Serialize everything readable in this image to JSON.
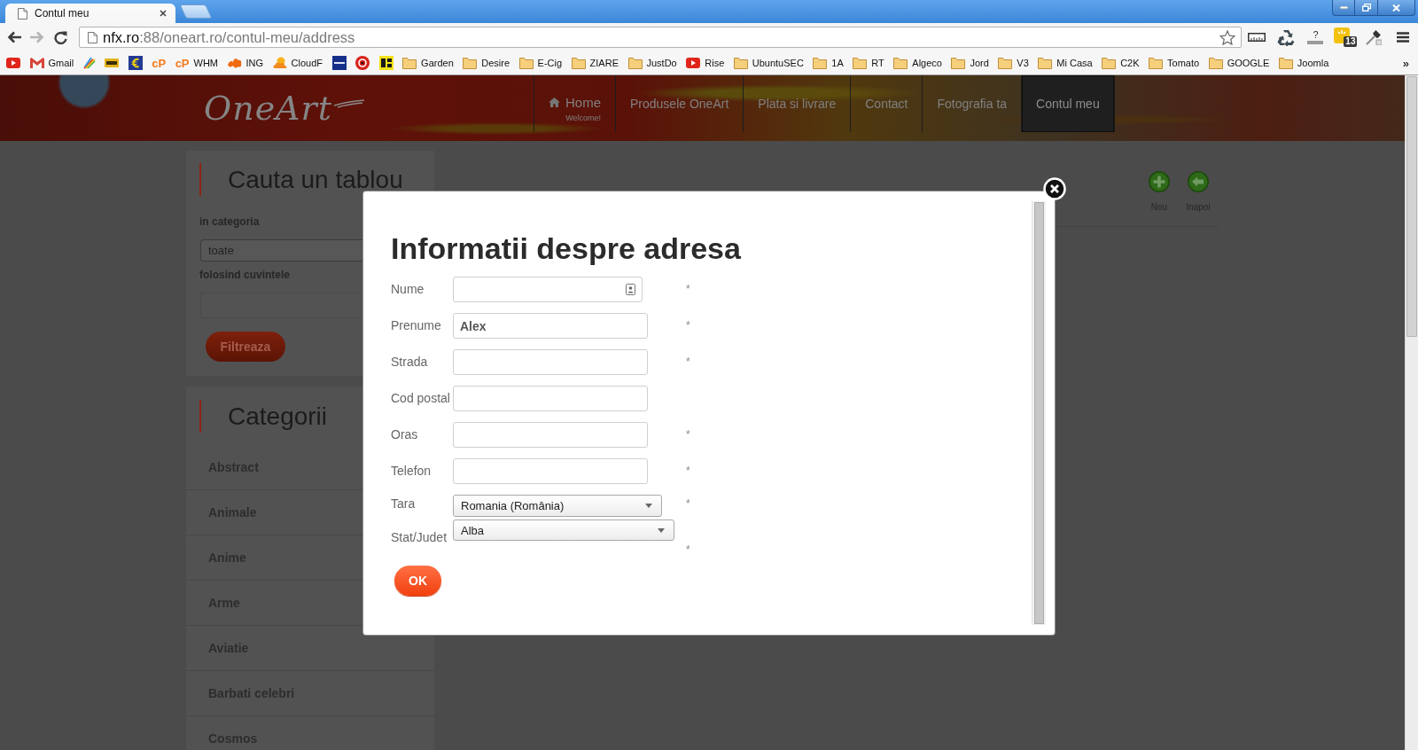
{
  "browser": {
    "tab": {
      "title": "Contul meu"
    },
    "address": {
      "host": "nfx.ro",
      "path": ":88/oneart.ro/contul-meu/address"
    },
    "extensions": [
      {
        "kind": "ruler"
      },
      {
        "kind": "recycle"
      },
      {
        "kind": "help",
        "glyph": "?"
      },
      {
        "kind": "notifier",
        "badge": "13"
      },
      {
        "kind": "dropper"
      },
      {
        "kind": "menu"
      }
    ],
    "bookmarks": [
      {
        "kind": "youtube"
      },
      {
        "kind": "gmail",
        "label": "Gmail"
      },
      {
        "kind": "brush"
      },
      {
        "kind": "imdb"
      },
      {
        "kind": "euro"
      },
      {
        "kind": "cpanel",
        "glyph": "cP"
      },
      {
        "kind": "cpanel",
        "glyph": "cP",
        "label": "WHM"
      },
      {
        "kind": "lion",
        "label": "ING"
      },
      {
        "kind": "cloud",
        "label": "CloudF"
      },
      {
        "kind": "twc"
      },
      {
        "kind": "ball"
      },
      {
        "kind": "cdt"
      },
      {
        "kind": "folder",
        "label": "Garden"
      },
      {
        "kind": "folder",
        "label": "Desire"
      },
      {
        "kind": "folder",
        "label": "E-Cig"
      },
      {
        "kind": "folder",
        "label": "ZIARE"
      },
      {
        "kind": "folder",
        "label": "JustDo"
      },
      {
        "kind": "youtube",
        "label": "Rise"
      },
      {
        "kind": "folder",
        "label": "UbuntuSEC"
      },
      {
        "kind": "folder",
        "label": "1A"
      },
      {
        "kind": "folder",
        "label": "RT"
      },
      {
        "kind": "folder",
        "label": "Algeco"
      },
      {
        "kind": "folder",
        "label": "Jord"
      },
      {
        "kind": "folder",
        "label": "V3"
      },
      {
        "kind": "folder",
        "label": "Mi Casa"
      },
      {
        "kind": "folder",
        "label": "C2K"
      },
      {
        "kind": "folder",
        "label": "Tomato"
      },
      {
        "kind": "folder",
        "label": "GOOGLE"
      },
      {
        "kind": "folder",
        "label": "Joomla"
      }
    ],
    "overflow": "»"
  },
  "site": {
    "logo": "OneArt",
    "nav": [
      {
        "kind": "home",
        "label": "Home",
        "subtitle": "Welcome!",
        "selected": false
      },
      {
        "kind": "link",
        "label": "Produsele OneArt",
        "selected": false
      },
      {
        "kind": "link",
        "label": "Plata si livrare",
        "selected": false
      },
      {
        "kind": "link",
        "label": "Contact",
        "selected": false
      },
      {
        "kind": "link",
        "label": "Fotografia ta",
        "selected": false
      },
      {
        "kind": "link",
        "label": "Contul meu",
        "selected": true
      }
    ]
  },
  "sidebar": {
    "search": {
      "title": "Cauta un tablou",
      "category_label": "in categoria",
      "category_value": "toate",
      "keywords_label": "folosind cuvintele",
      "button": "Filtreaza"
    },
    "categories": {
      "title": "Categorii",
      "items": [
        "Abstract",
        "Animale",
        "Anime",
        "Arme",
        "Aviatie",
        "Barbati celebri",
        "Cosmos"
      ]
    }
  },
  "toolbar": {
    "actions": [
      {
        "kind": "add",
        "label": "Nou"
      },
      {
        "kind": "back",
        "label": "Inapoi"
      }
    ]
  },
  "dialog": {
    "title": "Informatii despre adresa",
    "fields": [
      {
        "kind": "contact",
        "label": "Nume",
        "mark": "*"
      },
      {
        "kind": "text",
        "label": "Prenume",
        "value": "Alex",
        "mark": "*"
      },
      {
        "kind": "text",
        "label": "Strada",
        "mark": "*"
      },
      {
        "kind": "text",
        "label": "Cod postal"
      },
      {
        "kind": "text",
        "label": "Oras",
        "mark": "*"
      },
      {
        "kind": "text",
        "label": "Telefon",
        "mark": "*"
      },
      {
        "kind": "select",
        "label": "Tara",
        "value": "Romania (România)",
        "mark": "*"
      },
      {
        "kind": "select",
        "label": "Stat/Judet",
        "value": "Alba",
        "mark": "*"
      }
    ],
    "button": "OK"
  }
}
